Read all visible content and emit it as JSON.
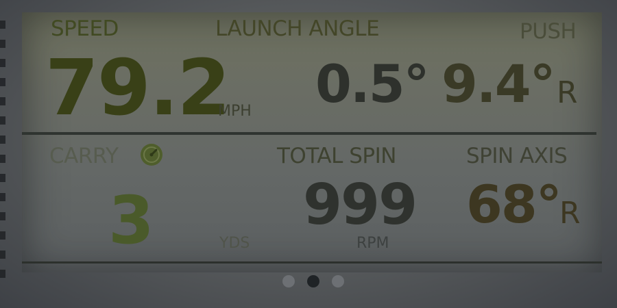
{
  "top_row": {
    "speed": {
      "label": "SPEED",
      "value": "79.2",
      "unit": "MPH"
    },
    "launch_angle": {
      "label": "LAUNCH ANGLE",
      "value": "0.5°"
    },
    "push": {
      "label": "PUSH",
      "value": "9.4°",
      "suffix": "R"
    }
  },
  "bottom_row": {
    "carry": {
      "label": "CARRY",
      "value": "3",
      "unit": "YDS",
      "icon": "pace-dial-icon"
    },
    "total_spin": {
      "label": "TOTAL SPIN",
      "value": "999",
      "unit": "RPM"
    },
    "spin_axis": {
      "label": "SPIN AXIS",
      "value": "68°",
      "suffix": "R"
    }
  },
  "pagination": {
    "pages": 3,
    "active_index": 1
  },
  "colors": {
    "screen": "#6a6d64",
    "active_dot": "#1f2326",
    "inactive_dot": "#6d7074",
    "carry_green": "#4a5a2a"
  }
}
